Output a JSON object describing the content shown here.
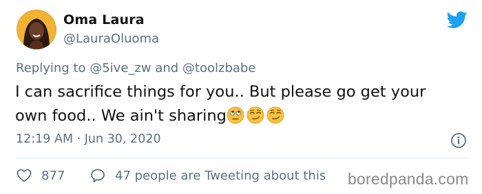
{
  "tweet": {
    "display_name": "Oma Laura",
    "handle": "@LauraOluoma",
    "replying_prefix": "Replying to",
    "replying_to": [
      "@5ive_zw",
      "@toolzbabe"
    ],
    "replying_conjunction": "and",
    "text_line1": "I can sacrifice things for you.. But please go get your",
    "text_line2": "own food.. We ain't sharing",
    "emojis": [
      "face-with-rolling-eyes-emoji",
      "smirking-face-emoji",
      "smirking-face-emoji"
    ],
    "timestamp": "12:19 AM · Jun 30, 2020",
    "like_count": "877",
    "conversation_text": "47 people are Tweeting about this"
  },
  "watermark": "boredpanda.com",
  "icons": {
    "brand": "twitter-bird-icon",
    "info": "info-icon",
    "like": "heart-icon",
    "reply": "speech-bubble-icon"
  },
  "colors": {
    "twitter_blue": "#1da1f2",
    "secondary_text": "#5b7083",
    "primary_text": "#111111",
    "divider": "#e1e8ed",
    "emoji_yellow": "#f7c13f"
  }
}
